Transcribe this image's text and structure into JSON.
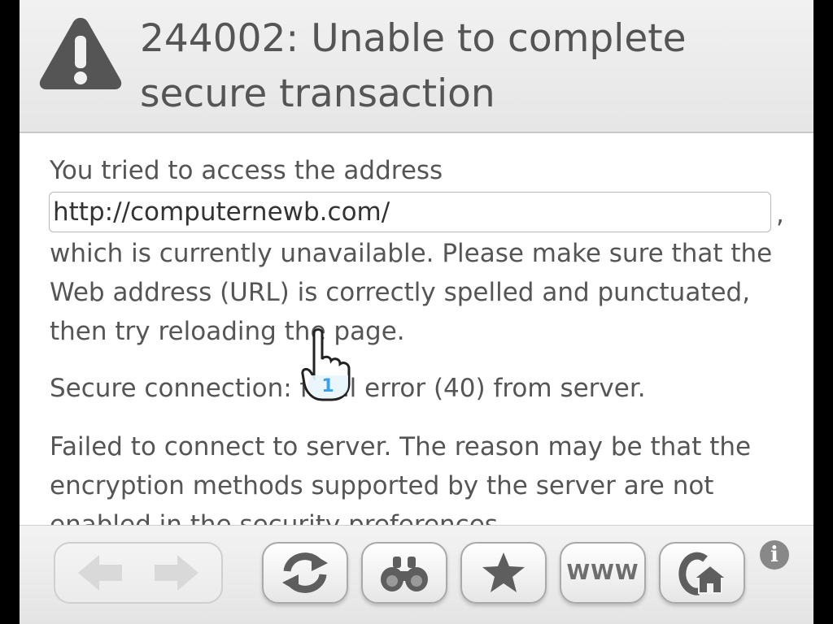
{
  "error": {
    "title": "244002: Unable to complete secure transaction",
    "intro": "You tried to access the address",
    "url": "http://computernewb.com/",
    "url_suffix": ",",
    "unavailable": "which is currently unavailable. Please make sure that the Web address (URL) is correctly spelled and punctuated, then try reloading the page.",
    "secure_error": "Secure connection: fatal error (40) from server.",
    "failed": "Failed to connect to server. The reason may be that the encryption methods supported by the server are not enabled in the security preferences."
  },
  "toolbar": {
    "www_label": "WWW",
    "info_label": "i",
    "icons": [
      "back-arrow-icon",
      "forward-arrow-icon",
      "reload-icon",
      "binoculars-icon",
      "star-icon",
      "www-icon",
      "home-icon",
      "info-icon"
    ]
  },
  "cursor": {
    "player_number": "1"
  },
  "colors": {
    "text": "#555555",
    "header_bg": "#e9e9e9",
    "icon_gray": "#5e5e5e",
    "cursor_blue": "#3aa0e8"
  }
}
